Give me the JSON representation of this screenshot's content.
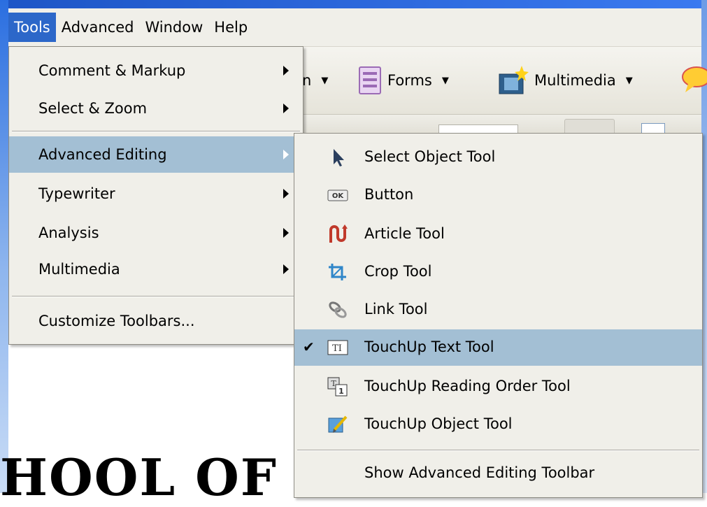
{
  "menubar": {
    "items": [
      "Tools",
      "Advanced",
      "Window",
      "Help"
    ]
  },
  "toolbar": {
    "partial_label": "n",
    "forms_label": "Forms",
    "multimedia_label": "Multimedia"
  },
  "tools_menu": {
    "items": [
      {
        "label": "Comment & Markup",
        "mnemonic": "C"
      },
      {
        "label": "Select & Zoom",
        "mnemonic": "Z"
      },
      {
        "label": "Advanced Editing",
        "mnemonic": "A"
      },
      {
        "label": "Typewriter",
        "mnemonic": "w"
      },
      {
        "label": "Analysis",
        "mnemonic": "y"
      },
      {
        "label": "Multimedia",
        "mnemonic": "M"
      },
      {
        "label": "Customize Toolbars...",
        "mnemonic": "u"
      }
    ]
  },
  "advanced_editing_submenu": {
    "items": [
      {
        "label": "Select Object Tool",
        "icon": "cursor-arrow-icon"
      },
      {
        "label": "Button",
        "icon": "ok-button-icon"
      },
      {
        "label": "Article Tool",
        "icon": "article-tool-icon"
      },
      {
        "label": "Crop Tool",
        "icon": "crop-tool-icon"
      },
      {
        "label": "Link Tool",
        "icon": "link-chain-icon"
      },
      {
        "label": "TouchUp Text Tool",
        "icon": "touchup-text-icon",
        "checked": true
      },
      {
        "label": "TouchUp Reading Order Tool",
        "icon": "touchup-reading-order-icon"
      },
      {
        "label": "TouchUp Object Tool",
        "icon": "touchup-object-icon"
      },
      {
        "label": "Show Advanced Editing Toolbar"
      }
    ]
  },
  "document": {
    "visible_text": "HOOL OF N"
  },
  "colors": {
    "menu_bg": "#f0efe9",
    "highlight": "#a3bfd4",
    "menubar_active": "#2c67c9"
  }
}
